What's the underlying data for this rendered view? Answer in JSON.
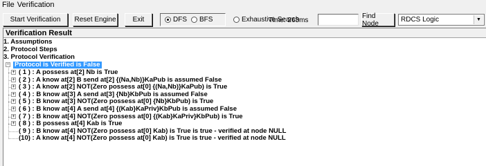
{
  "menu": [
    "File",
    "Verification"
  ],
  "toolbar": {
    "start": "Start Verification",
    "reset": "Reset Engine",
    "exit": "Exit",
    "dfs": "DFS",
    "bfs": "BFS",
    "exhaustive": "Exhaustive Search",
    "time": "Time: 263ms",
    "find_value": "",
    "find": "Find Node",
    "logic": "RDCS Logic"
  },
  "panel": {
    "title": "Verification Result",
    "sections": [
      "1. Assumptions",
      "2. Protocol Steps",
      "3. Protocol Verification"
    ],
    "root": "Protocol is Verified is False",
    "nodes": [
      "( 1 ) : A possess at[2] Nb is True",
      "( 2 ) : A know at[2] B send at[2] {(Na,Nb)}KaPub is assumed False",
      "( 3 ) : A know at[2] NOT(Zero possess at[0] {(Na,Nb)}KaPub) is True",
      "( 4 ) : B know at[3] A send at[3] {Nb}KbPub is assumed False",
      "( 5 ) : B know at[3] NOT(Zero possess at[0] {Nb}KbPub) is True",
      "( 6 ) : B know at[4] A send at[4] {(Kab}KaPriv}KbPub is assumed False",
      "( 7 ) : B know at[4] NOT(Zero possess at[0] {(Kab}KaPriv}KbPub) is True",
      "( 8 ) : B possess at[4] Kab is True",
      "( 9 ) : B know at[4] NOT(Zero possess at[0] Kab) is True is true - verified at node NULL",
      "(10) : A know at[4] NOT(Zero possess at[0] Kab) is True is true - verified at node NULL"
    ]
  }
}
